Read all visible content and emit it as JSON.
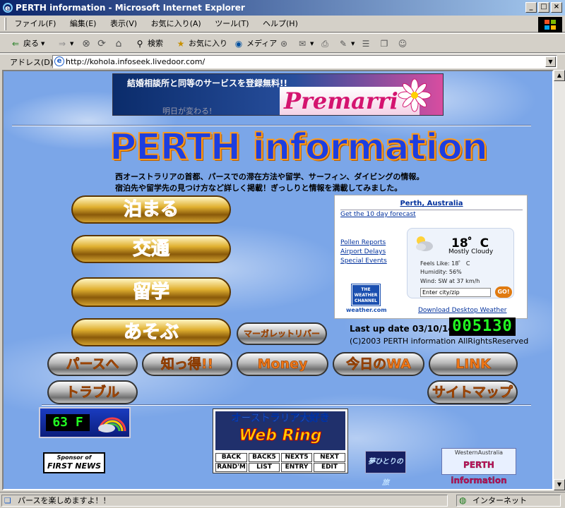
{
  "window": {
    "title": "PERTH  information - Microsoft Internet Explorer",
    "min": "_",
    "max": "□",
    "close": "×"
  },
  "menu": [
    "ファイル(F)",
    "編集(E)",
    "表示(V)",
    "お気に入り(A)",
    "ツール(T)",
    "ヘルプ(H)"
  ],
  "toolbar": {
    "back": "戻る",
    "search": "検索",
    "favorites": "お気に入り",
    "media": "メディア"
  },
  "address": {
    "label": "アドレス(D)",
    "url": "http://kohola.infoseek.livedoor.com/"
  },
  "banner": {
    "text": "結婚相談所と同等のサービスを登録無料!!",
    "brand": "Premarri",
    "fine": "明日が変わる!"
  },
  "page": {
    "title": "PERTH information",
    "desc1": "西オーストラリアの首都、パースでの滞在方法や留学、サーフィン、ダイビングの情報。",
    "desc2": "宿泊先や留学先の見つけ方など詳しく掲載！ぎっしりと情報を満載してみました。"
  },
  "nav": {
    "tomaru": "泊まる",
    "kotsu": "交通",
    "ryugaku": "留学",
    "asobu": "あそぶ",
    "margaret": "マーガレットリバー",
    "perth": "パースへ",
    "shittoku": "知っ得!!",
    "money": "Money",
    "wa": "今日のWA",
    "link": "LINK",
    "trouble": "トラブル",
    "sitemap": "サイトマップ"
  },
  "weather": {
    "city": "Perth, Australia",
    "forecast": "Get the 10 day forecast",
    "pollen": "Pollen Reports",
    "airport": "Airport Delays",
    "events": "Special Events",
    "temp": "18゜C",
    "cond": "Mostly Cloudy",
    "feels": "Feels Like: 18゜ C",
    "humidity": "Humidity: 56%",
    "wind": "Wind: SW at 37 km/h",
    "search_placeholder": "Enter city/zip",
    "go": "GO!",
    "channel": "THE WEATHER CHANNEL",
    "site": "weather.com",
    "download": "Download Desktop Weather"
  },
  "update": {
    "label": "Last up date 03/10/14",
    "counter": "005130",
    "copyright": "(C)2003 PERTH information AllRightsReserved"
  },
  "temp_widget": {
    "value": "63 F"
  },
  "webring": {
    "title1": "オーストラリア大好き",
    "title2": "Web Ring",
    "buttons": [
      "BACK",
      "BACK5",
      "NEXT5",
      "NEXT",
      "RAND'M",
      "LIST",
      "ENTRY",
      "EDIT"
    ]
  },
  "sponsor": {
    "line1": "Sponsor of",
    "line2": "FIRST NEWS"
  },
  "yume": "夢ひとりの旅",
  "wa_banner": {
    "line1": "WesternAustralia",
    "line2": "PERTH information"
  },
  "status": {
    "text": "パースを楽しめますよ！！",
    "zone": "インターネット"
  }
}
